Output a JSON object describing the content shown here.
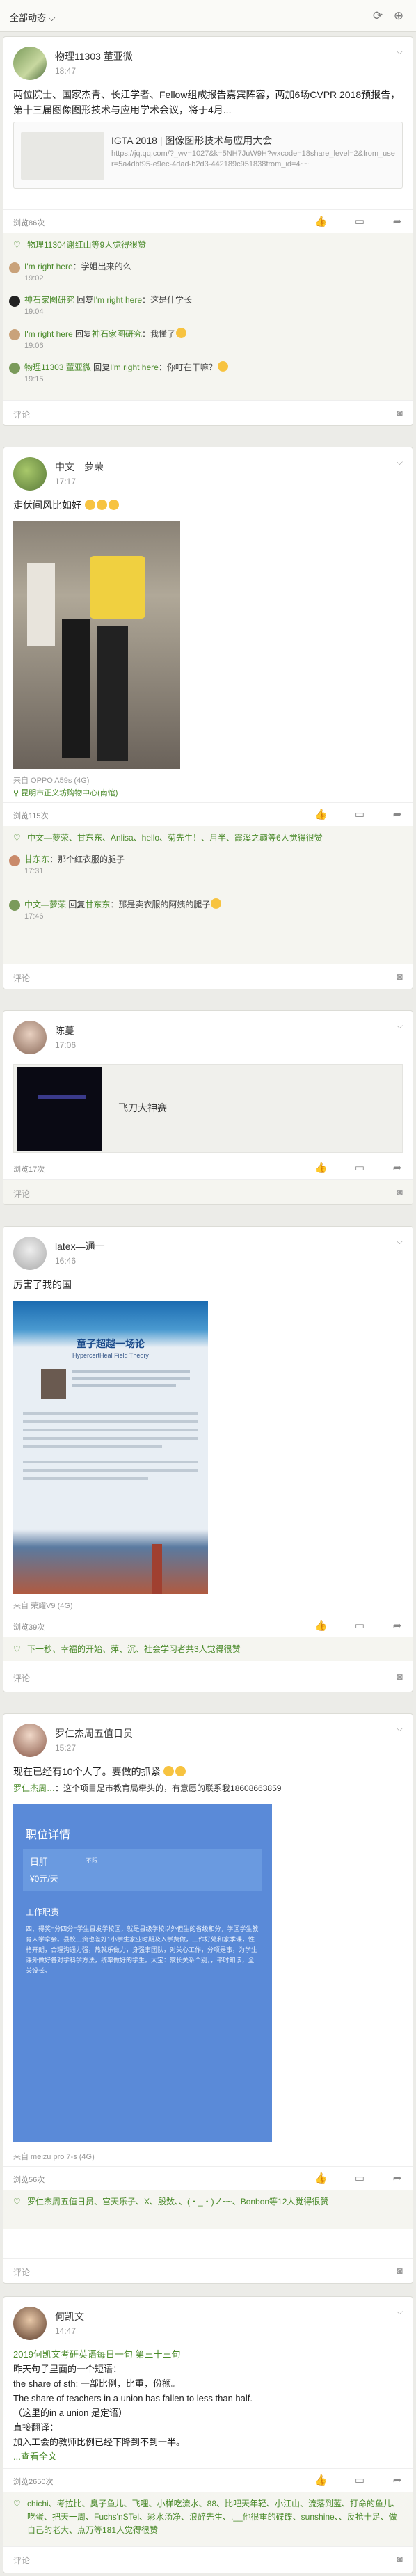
{
  "header": {
    "filter_label": "全部动态 ⌵",
    "refresh_icon": "refresh-icon",
    "add_icon": "add-circle-icon"
  },
  "post1": {
    "name": "物理11303 董亚微",
    "time": "18:47",
    "text": "两位院士、国家杰青、长江学者、Fellow组成报告嘉宾阵容，两加6场CVPR 2018预报告，第十三届图像图形技术与应用学术会议，将于4月...",
    "link_title": "IGTA 2018 | 图像图形技术与应用大会",
    "link_url": "https://jq.qq.com/?_wv=1027&k=5NH7JuW9H?wxcode=18share_level=2&from_user=5a4dbf95-e9ec-4dad-b2d3-442189c951838from_id=4~~",
    "reads": "浏览86次",
    "likes": "物理11304谢红山等9人觉得很赞",
    "comments": [
      {
        "name": "I'm right here",
        "text": "：学姐出来的么",
        "time": "19:02"
      },
      {
        "name": "神石家图研究",
        "reply_to": "I'm right here",
        "text": "：这是什学长",
        "time": "19:04"
      },
      {
        "name": "I'm right here",
        "reply_to": "神石家图研究",
        "text": "：我懂了",
        "time": "19:06"
      },
      {
        "name": "物理11303 董亚微",
        "reply_to": "I'm right here",
        "text": "：你叮在干嘛？",
        "time": "19:15"
      }
    ],
    "comment_placeholder": "评论"
  },
  "post2": {
    "name": "中文—萝荣",
    "time": "17:17",
    "text": "走伏间风比如好",
    "source": "来自 OPPO A59s (4G)",
    "location": "昆明市正义坊购物中心(南馆)",
    "reads": "浏览115次",
    "likes": "中文—萝荣、甘东东、Anlisa、hello、菊先生！、月半、霞溪之巅",
    "likes_suffix": "等6人觉得很赞",
    "comments": [
      {
        "name": "甘东东",
        "text": "：那个红衣服的腿子",
        "time": "17:31"
      },
      {
        "name": "中文—萝荣",
        "reply_to": "甘东东",
        "text": "：那是卖衣服的阿姨的腿子",
        "time": "17:46"
      }
    ],
    "comment_placeholder": "评论"
  },
  "post3": {
    "name": "陈蔓",
    "time": "17:06",
    "link_title": "飞刀大神赛",
    "reads": "浏览17次",
    "comment_placeholder": "评论"
  },
  "post4": {
    "name": "latex—通一",
    "time": "16:46",
    "text": "厉害了我的国",
    "poster_title": "童子超越一场论",
    "poster_subtitle": "HypercertHeal Field Theory",
    "source": "来自 荣耀V9 (4G)",
    "reads": "浏览39次",
    "likes": "下一秒、幸福的开始、萍、沉、社会学习者共3人觉得很赞",
    "comment_placeholder": "评论"
  },
  "post5": {
    "name": "罗仁杰周五值日员",
    "time": "15:27",
    "text": "现在已经有10个人了。要做的抓紧",
    "line2_prefix": "罗仁杰周…",
    "line2": "：这个项目是市教育局牵头的，有意愿的联系我18608663859",
    "job_title": "职位详情",
    "job_company": "日肝",
    "job_tag": "不限",
    "job_salary": "¥0元/天",
    "job_section": "工作职责",
    "job_desc": "四、得奖=分四分=学生县发学校区，就是县级学校以外但生的省级和分，学区学生教育人学拿会。县校工资也差好1小学生家业时期及入学费做，工作好处和家季课，性格开朗，合理沟通力强，热就乐做力，身强事团队，对关心工作，分项是事，为学生课外做好各对学科学方法，统率做好的学生。大宝：家长关系个别，，平时知该，全关设长。",
    "source": "来自 meizu pro 7-s (4G)",
    "reads": "浏览56次",
    "likes": "罗仁杰周五值日员、宫天乐子、X、殷数、、(・_・)ノ~~、Bonbon等12人觉得很赞",
    "comment_placeholder": "评论"
  },
  "post6": {
    "name": "何凯文",
    "time": "14:47",
    "line1": "2019何凯文考研英语每日一句 第三十三句",
    "line2": "昨天句子里面的一个短语：",
    "line3": "the share of sth: 一部比例，比重，份额。",
    "line4": "The share of teachers in a union has fallen to less than half.",
    "line5": "（这里的in a union 是定语）",
    "line6": "直接翻译：",
    "line7": "加入工会的教师比例已经下降到不到一半。",
    "more": "...查看全文",
    "reads": "浏览2650次",
    "likes": "chichi、考拉比、臭子鱼儿、飞哩、小样吃流水、88、比吧天年轻、小江山、流落到蓝、打命的鱼儿、吃蛋、把天一周、Fuchs'nSTel、彩水汤净、浪醉先生、.__他很重的碟碟、sunshine、、反抢十足、做自己的老大、点万等181人觉得很赞",
    "comment_placeholder": "评论"
  }
}
